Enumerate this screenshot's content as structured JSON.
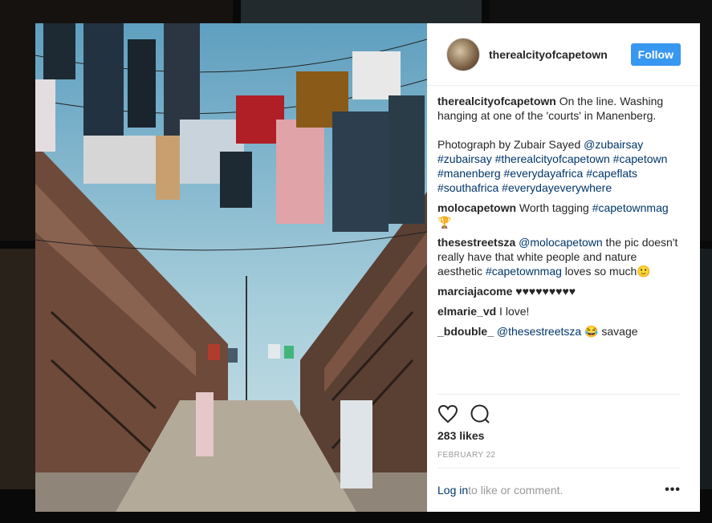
{
  "background": {
    "tile_colors": [
      "#3a302a",
      "#5a6f7a",
      "#2b2b2b",
      "#6b5a48",
      "#4a4440",
      "#3d4a52"
    ]
  },
  "post": {
    "username": "therealcityofcapetown",
    "follow_label": "Follow",
    "caption": {
      "author": "therealcityofcapetown",
      "text1": " On the line. Washing hanging at one of the 'courts' in Manenberg.",
      "text2": "Photograph by Zubair Sayed ",
      "mention": "@zubairsay",
      "hashtags": "#zubairsay #therealcityofcapetown #capetown #manenberg #everydayafrica #capeflats #southafrica #everydayeverywhere"
    },
    "comments": [
      {
        "author": "molocapetown",
        "text": " Worth tagging ",
        "tag": "#capetownmag",
        "emoji": "🏆"
      },
      {
        "author": "thesestreetsza",
        "mention": " @molocapetown",
        "text": " the pic doesn't really have that white people and nature aesthetic ",
        "tag": "#capetownmag",
        "text2": " loves so much",
        "emoji": "🙂"
      },
      {
        "author": "marciajacome",
        "text": " ♥♥♥♥♥♥♥♥♥"
      },
      {
        "author": "elmarie_vd",
        "text": " I love!"
      },
      {
        "author": "_bdouble_",
        "mention": " @thesestreetsza",
        "emoji": " 😂",
        "text": " savage"
      }
    ],
    "likes": "283 likes",
    "date": "FEBRUARY 22",
    "login_link": "Log in",
    "login_rest": " to like or comment.",
    "more": "•••",
    "icons": {
      "like": "heart-icon",
      "comment": "comment-bubble-icon"
    }
  }
}
